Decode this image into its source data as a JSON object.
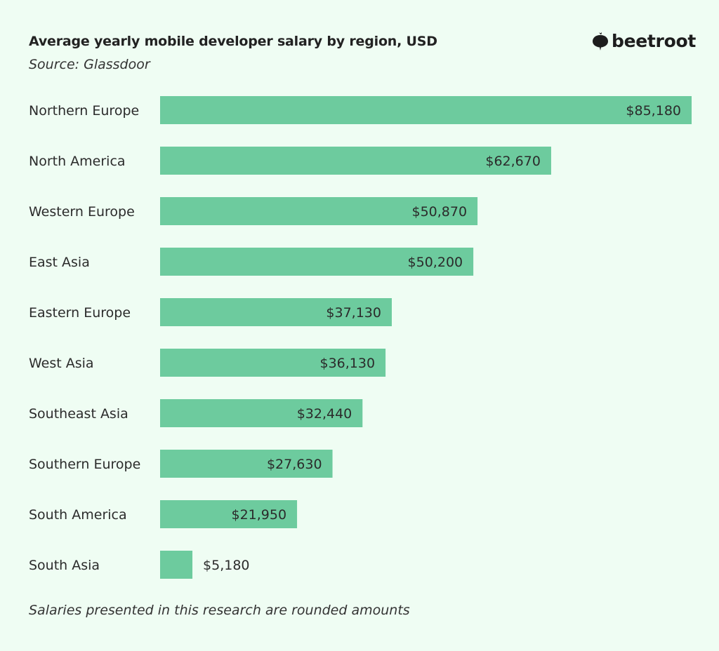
{
  "header": {
    "title": "Average yearly mobile developer salary by region, USD",
    "subtitle": "Source: Glassdoor",
    "logo_text": "beetroot"
  },
  "footnote": "Salaries presented in this research are rounded amounts",
  "colors": {
    "bar": "#6dcb9e",
    "background": "#effdf3",
    "text": "#2b2b2b"
  },
  "chart_data": {
    "type": "bar",
    "orientation": "horizontal",
    "title": "Average yearly mobile developer salary by region, USD",
    "subtitle": "Source: Glassdoor",
    "xlabel": "",
    "ylabel": "",
    "xlim": [
      0,
      85180
    ],
    "grid": false,
    "categories": [
      "Northern Europe",
      "North America",
      "Western Europe",
      "East Asia",
      "Eastern Europe",
      "West Asia",
      "Southeast Asia",
      "Southern Europe",
      "South America",
      "South Asia"
    ],
    "values": [
      85180,
      62670,
      50870,
      50200,
      37130,
      36130,
      32440,
      27630,
      21950,
      5180
    ],
    "value_labels": [
      "$85,180",
      "$62,670",
      "$50,870",
      "$50,200",
      "$37,130",
      "$36,130",
      "$32,440",
      "$27,630",
      "$21,950",
      "$5,180"
    ]
  }
}
